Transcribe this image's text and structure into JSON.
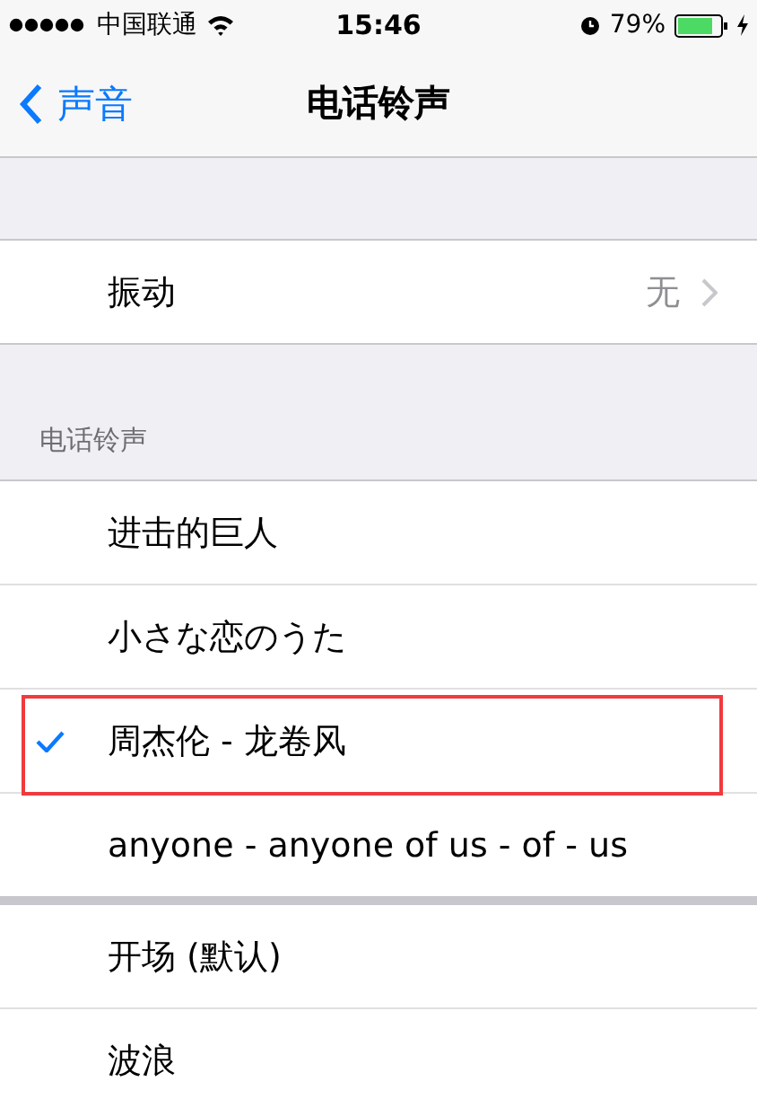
{
  "status_bar": {
    "carrier": "中国联通",
    "time": "15:46",
    "battery": "79%"
  },
  "nav": {
    "back": "声音",
    "title": "电话铃声"
  },
  "vibration": {
    "label": "振动",
    "value": "无"
  },
  "section_header": "电话铃声",
  "custom_ringtones": [
    {
      "label": "进击的巨人",
      "selected": false,
      "annotated": false
    },
    {
      "label": "小さな恋のうた",
      "selected": false,
      "annotated": false
    },
    {
      "label": "周杰伦 - 龙卷风",
      "selected": true,
      "annotated": true
    },
    {
      "label": "anyone - anyone of us - of - us",
      "selected": false,
      "annotated": false
    }
  ],
  "ringtones": [
    {
      "label": "开场 (默认)",
      "selected": false
    },
    {
      "label": "波浪",
      "selected": false
    }
  ]
}
